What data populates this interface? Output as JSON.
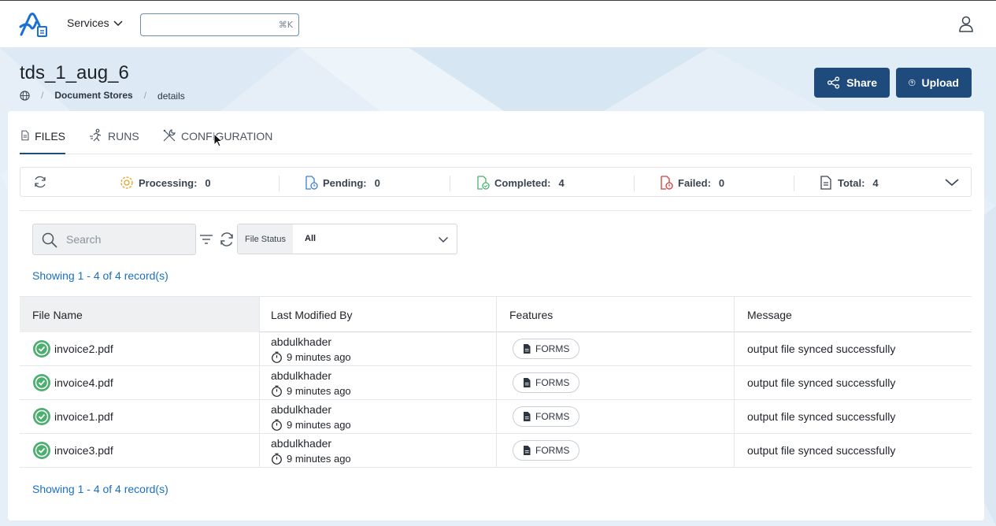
{
  "header": {
    "services_label": "Services",
    "search_shortcut": "⌘K",
    "search_placeholder": ""
  },
  "page": {
    "title": "tds_1_aug_6",
    "breadcrumb": [
      "Document Stores",
      "details"
    ]
  },
  "actions": {
    "share_label": "Share",
    "upload_label": "Upload"
  },
  "tabs": [
    {
      "label": "FILES",
      "active": true,
      "icon": "file-icon"
    },
    {
      "label": "RUNS",
      "active": false,
      "icon": "runner-icon"
    },
    {
      "label": "CONFIGURATION",
      "active": false,
      "icon": "tools-icon"
    }
  ],
  "stats": {
    "processing": {
      "label": "Processing:",
      "value": "0"
    },
    "pending": {
      "label": "Pending:",
      "value": "0"
    },
    "completed": {
      "label": "Completed:",
      "value": "4"
    },
    "failed": {
      "label": "Failed:",
      "value": "0"
    },
    "total": {
      "label": "Total:",
      "value": "4"
    }
  },
  "filters": {
    "search_placeholder": "Search",
    "status_label": "File Status",
    "status_value": "All"
  },
  "showing_text": "Showing 1 - 4 of 4 record(s)",
  "table": {
    "columns": [
      "File Name",
      "Last Modified By",
      "Features",
      "Message"
    ],
    "rows": [
      {
        "file": "invoice2.pdf",
        "user": "abdulkhader",
        "time": "9 minutes ago",
        "feature": "FORMS",
        "message": "output file synced successfully"
      },
      {
        "file": "invoice4.pdf",
        "user": "abdulkhader",
        "time": "9 minutes ago",
        "feature": "FORMS",
        "message": "output file synced successfully"
      },
      {
        "file": "invoice1.pdf",
        "user": "abdulkhader",
        "time": "9 minutes ago",
        "feature": "FORMS",
        "message": "output file synced successfully"
      },
      {
        "file": "invoice3.pdf",
        "user": "abdulkhader",
        "time": "9 minutes ago",
        "feature": "FORMS",
        "message": "output file synced successfully"
      }
    ]
  },
  "colors": {
    "primary": "#1f4a7c",
    "link": "#1a6fc4",
    "success": "#4caf70",
    "processing": "#e0a528",
    "pending": "#3b7dd8",
    "failed": "#d63a3a"
  }
}
